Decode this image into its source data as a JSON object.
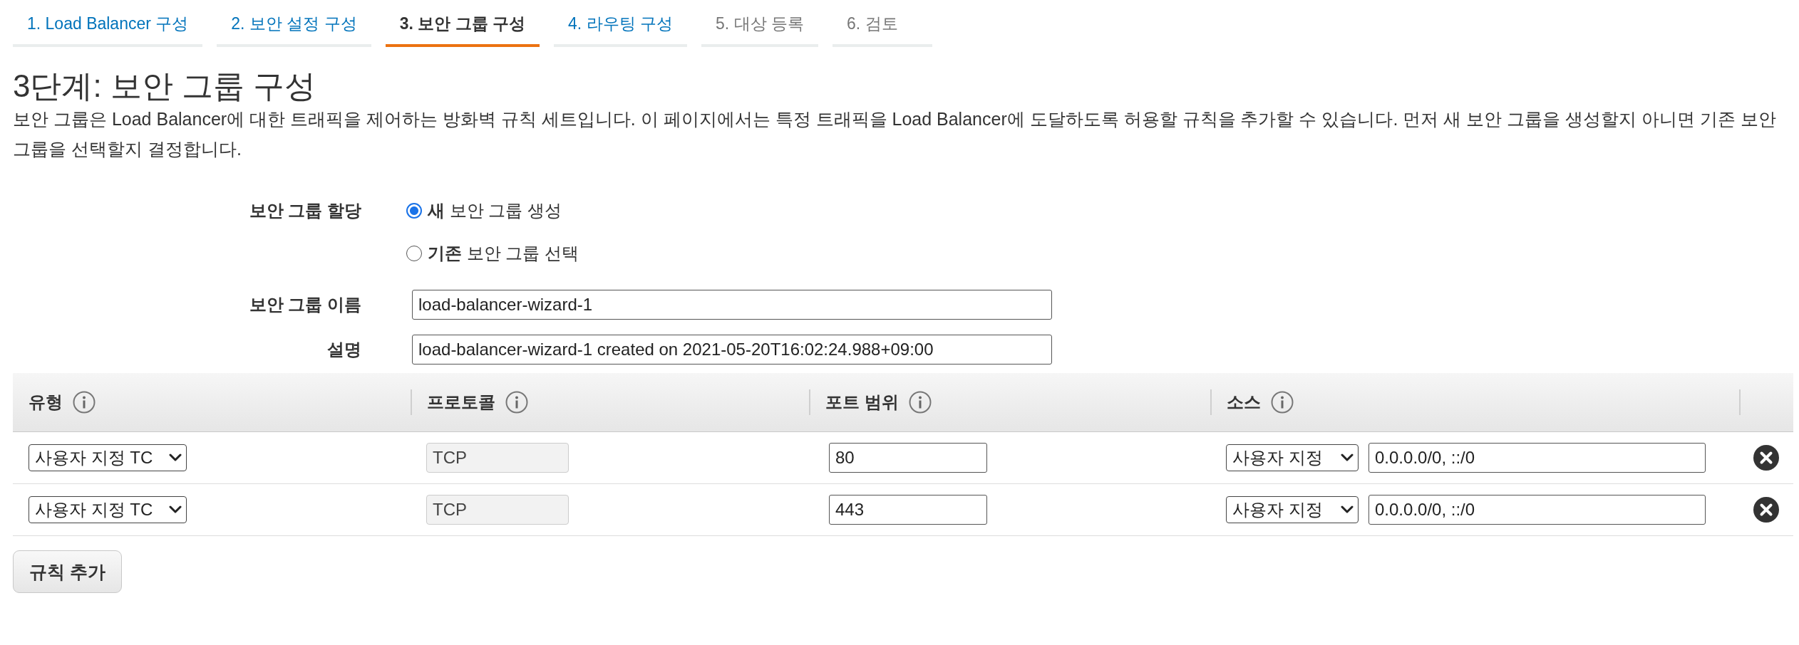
{
  "wizard_steps": [
    {
      "label": "1. Load Balancer 구성",
      "selected": false,
      "disabled": false
    },
    {
      "label": "2. 보안 설정 구성",
      "selected": false,
      "disabled": false
    },
    {
      "label": "3. 보안 그룹 구성",
      "selected": true,
      "disabled": false
    },
    {
      "label": "4. 라우팅 구성",
      "selected": false,
      "disabled": false
    },
    {
      "label": "5. 대상 등록",
      "selected": false,
      "disabled": true
    },
    {
      "label": "6. 검토",
      "selected": false,
      "disabled": true
    }
  ],
  "heading": "3단계: 보안 그룹 구성",
  "description": "보안 그룹은 Load Balancer에 대한 트래픽을 제어하는 방화벽 규칙 세트입니다. 이 페이지에서는 특정 트래픽을 Load Balancer에 도달하도록 허용할 규칙을 추가할 수 있습니다. 먼저 새 보안 그룹을 생성할지 아니면 기존 보안 그룹을 선택할지 결정합니다.",
  "form": {
    "assignment": {
      "label": "보안 그룹 할당",
      "options": [
        {
          "label": "**새** 보안 그룹 생성",
          "selected": true
        },
        {
          "label": "**기존** 보안 그룹 선택",
          "selected": false
        }
      ]
    },
    "fields": [
      {
        "label": "보안 그룹 이름",
        "value": "load-balancer-wizard-1"
      },
      {
        "label": "설명",
        "value": "load-balancer-wizard-1 created on 2021-05-20T16:02:24.988+09:00"
      }
    ]
  },
  "rules_table": {
    "columns": [
      {
        "label": "유형"
      },
      {
        "label": "프로토콜"
      },
      {
        "label": "포트 범위"
      },
      {
        "label": "소스"
      }
    ],
    "rows": [
      {
        "type": "사용자 지정 TC",
        "protocol": {
          "value": "TCP",
          "disabled": true
        },
        "port_range": "80",
        "source_type": "사용자 지정",
        "source": "0.0.0.0/0, ::/0"
      },
      {
        "type": "사용자 지정 TC",
        "protocol": {
          "value": "TCP",
          "disabled": true
        },
        "port_range": "443",
        "source_type": "사용자 지정",
        "source": "0.0.0.0/0, ::/0"
      }
    ]
  },
  "add_rule_button": "규칙 추가"
}
